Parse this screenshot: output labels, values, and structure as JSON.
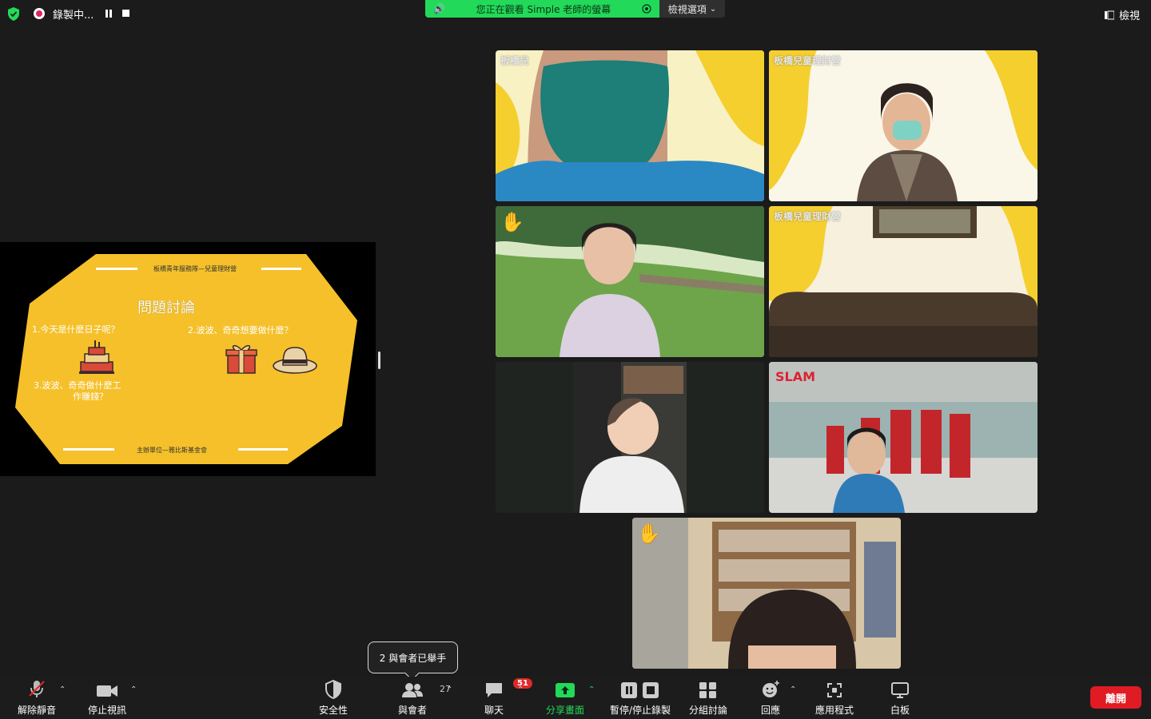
{
  "top_bar": {
    "recording_label": "錄製中...",
    "share_banner_text": "您正在觀看 Simple 老師的螢幕",
    "view_options_label": "檢視選項",
    "view_label": "檢視"
  },
  "shared_slide": {
    "header": "板橋青年服務隊—兒童理財營",
    "title": "問題討論",
    "question1": "1.今天是什麼日子呢？",
    "question2": "2.波波、奇奇想要做什麼？",
    "question3_line1": "3.波波、奇奇做什麼工",
    "question3_line2": "作賺錢？",
    "footer": "主辦單位—雅比斯基金會"
  },
  "video_tiles": [
    {
      "overlay": "板橋兒",
      "active": false,
      "hand_raised": false
    },
    {
      "overlay": "板橋兒童理財營",
      "active": false,
      "hand_raised": false
    },
    {
      "overlay": "",
      "active": true,
      "hand_raised": true
    },
    {
      "overlay": "板橋兒童理財營",
      "active": false,
      "hand_raised": false
    },
    {
      "overlay": "",
      "active": false,
      "hand_raised": false
    },
    {
      "overlay": "",
      "active": false,
      "hand_raised": false
    },
    {
      "overlay": "",
      "active": false,
      "hand_raised": true
    }
  ],
  "tooltip": "2 與會者已舉手",
  "toolbar": {
    "unmute": "解除靜音",
    "stop_video": "停止視訊",
    "security": "安全性",
    "participants": "與會者",
    "participants_count": "27",
    "chat": "聊天",
    "chat_badge": "51",
    "share_screen": "分享畫面",
    "pause_stop_recording": "暫停/停止錄製",
    "breakout_rooms": "分組討論",
    "reactions": "回應",
    "apps": "應用程式",
    "whiteboard": "白板",
    "leave": "離開"
  },
  "colors": {
    "accent_green": "#23d959",
    "leave_red": "#e01b24",
    "slide_yellow": "#f5c02a"
  }
}
